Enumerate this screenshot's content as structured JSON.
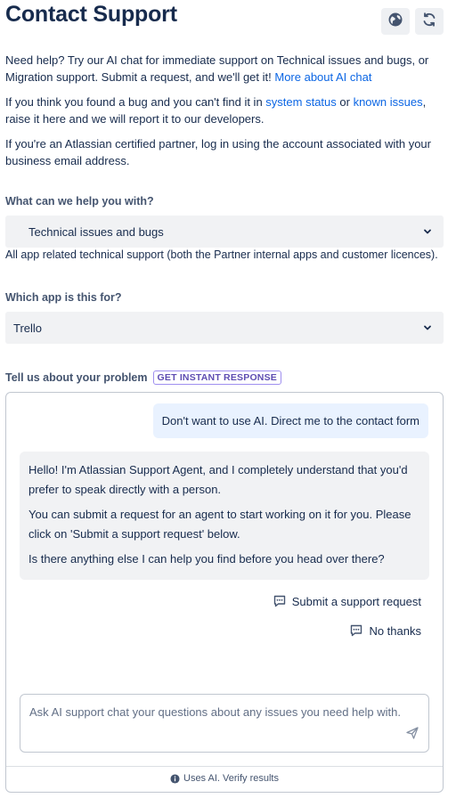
{
  "header": {
    "title": "Contact Support",
    "globe_icon": "globe-icon",
    "refresh_icon": "refresh-icon"
  },
  "intro": {
    "p1_text": "Need help? Try our AI chat for immediate support on Technical issues and bugs, or Migration support. Submit a request, and we'll get it! ",
    "p1_link": "More about AI chat",
    "p2_before": "If you think you found a bug and you can't find it in ",
    "p2_link1": "system status",
    "p2_mid": " or ",
    "p2_link2": "known issues",
    "p2_after": ", raise it here and we will report it to our developers.",
    "p3_text": "If you're an Atlassian certified partner, log in using the account associated with your business email address."
  },
  "form": {
    "help_label": "What can we help you with?",
    "help_value": "Technical issues and bugs",
    "help_description": "All app related technical support (both the Partner internal apps and customer licences).",
    "app_label": "Which app is this for?",
    "app_value": "Trello",
    "problem_label": "Tell us about your problem",
    "instant_badge": "GET INSTANT RESPONSE"
  },
  "chat": {
    "user_message": "Don't want to use AI. Direct me to the contact form",
    "agent_messages": [
      "Hello! I'm Atlassian Support Agent, and I completely understand that you'd prefer to speak directly with a person.",
      "You can submit a request for an agent to start working on it for you. Please click on 'Submit a support request' below.",
      "Is there anything else I can help you find before you head over there?"
    ],
    "action_submit": "Submit a support request",
    "action_no_thanks": "No thanks",
    "input_placeholder": "Ask AI support chat your questions about any issues you need help with.",
    "footer_note": "Uses AI. Verify results"
  },
  "colors": {
    "link": "#0c66e4",
    "user_bubble": "#e9f2ff",
    "agent_bubble": "#f1f2f4",
    "badge": "#5e4db2"
  }
}
